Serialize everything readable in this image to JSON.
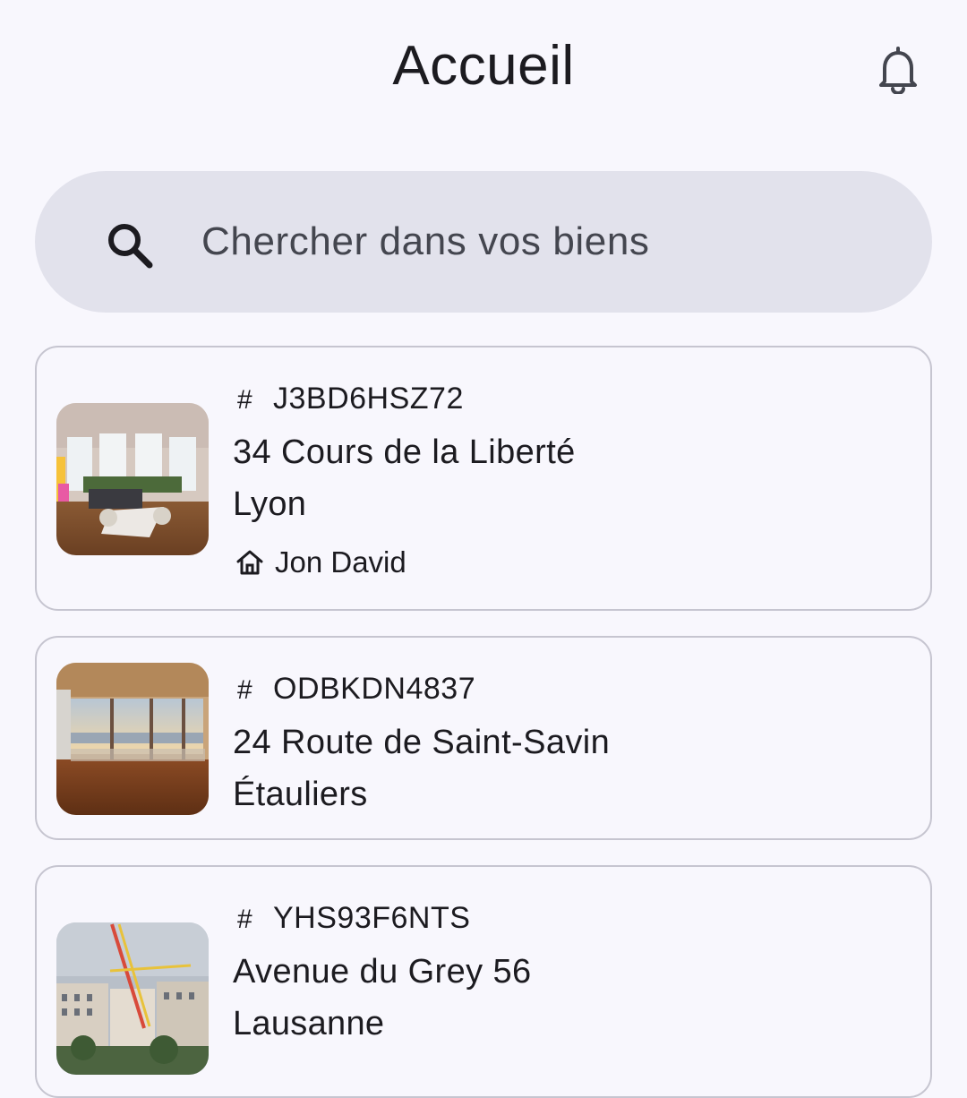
{
  "header": {
    "title": "Accueil",
    "bell_icon": "bell-outline-icon"
  },
  "search": {
    "placeholder": "Chercher dans vos biens",
    "icon": "search-icon"
  },
  "colors": {
    "background": "#f8f7fd",
    "search_bg": "#e2e2ec",
    "card_border": "#c6c5d0",
    "text": "#1c1b20"
  },
  "properties": [
    {
      "ref_symbol": "#",
      "ref": "J3BD6HSZ72",
      "address": "34 Cours de la Liberté",
      "city": "Lyon",
      "owner": "Jon David",
      "owner_icon": "home-icon",
      "photo": "living-room-photo"
    },
    {
      "ref_symbol": "#",
      "ref": "ODBKDN4837",
      "address": "24 Route de Saint-Savin",
      "city": "Étauliers",
      "photo": "empty-room-photo"
    },
    {
      "ref_symbol": "#",
      "ref": "YHS93F6NTS",
      "address": "Avenue du Grey 56",
      "city": "Lausanne",
      "photo": "construction-crane-photo"
    }
  ]
}
